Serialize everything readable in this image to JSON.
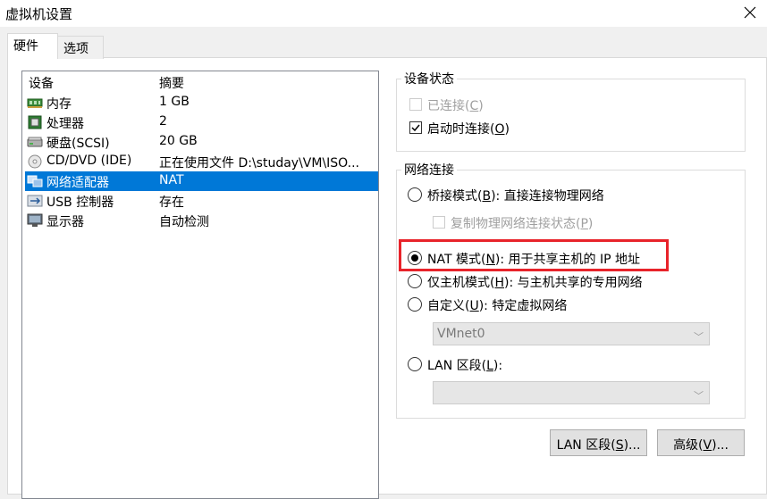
{
  "window": {
    "title": "虚拟机设置"
  },
  "tabs": [
    {
      "label": "硬件"
    },
    {
      "label": "选项"
    }
  ],
  "device_list": {
    "headers": {
      "device": "设备",
      "summary": "摘要"
    },
    "rows": [
      {
        "name": "内存",
        "summary": "1 GB",
        "icon": "memory-icon"
      },
      {
        "name": "处理器",
        "summary": "2",
        "icon": "processor-icon"
      },
      {
        "name": "硬盘(SCSI)",
        "summary": "20 GB",
        "icon": "harddisk-icon"
      },
      {
        "name": "CD/DVD (IDE)",
        "summary": "正在使用文件 D:\\studay\\VM\\ISO...",
        "icon": "cd-dvd-icon"
      },
      {
        "name": "网络适配器",
        "summary": "NAT",
        "icon": "network-adapter-icon",
        "selected": true
      },
      {
        "name": "USB 控制器",
        "summary": "存在",
        "icon": "usb-icon"
      },
      {
        "name": "显示器",
        "summary": "自动检测",
        "icon": "display-icon"
      }
    ]
  },
  "device_status": {
    "title": "设备状态",
    "connected": {
      "label": "已连接(",
      "key": "C",
      "suffix": ")",
      "checked": false,
      "enabled": false
    },
    "connect_on_power": {
      "label": "启动时连接(",
      "key": "O",
      "suffix": ")",
      "checked": true
    }
  },
  "network": {
    "title": "网络连接",
    "bridged": {
      "label": "桥接模式(",
      "key": "B",
      "suffix": "): 直接连接物理网络"
    },
    "replicate": {
      "label": "复制物理网络连接状态(",
      "key": "P",
      "suffix": ")"
    },
    "nat": {
      "label": "NAT 模式(",
      "key": "N",
      "suffix": "): 用于共享主机的 IP 地址",
      "selected": true
    },
    "host_only": {
      "label": "仅主机模式(",
      "key": "H",
      "suffix": "): 与主机共享的专用网络"
    },
    "custom": {
      "label": "自定义(",
      "key": "U",
      "suffix": "): 特定虚拟网络"
    },
    "custom_value": "VMnet0",
    "lan": {
      "label": "LAN 区段(",
      "key": "L",
      "suffix": "):"
    },
    "lan_value": ""
  },
  "buttons": {
    "lan_segments": {
      "label": "LAN 区段(",
      "key": "S",
      "suffix": ")..."
    },
    "advanced": {
      "label": "高级(",
      "key": "V",
      "suffix": ")..."
    }
  },
  "colors": {
    "selection": "#0078d7",
    "highlight": "#e8232a"
  }
}
